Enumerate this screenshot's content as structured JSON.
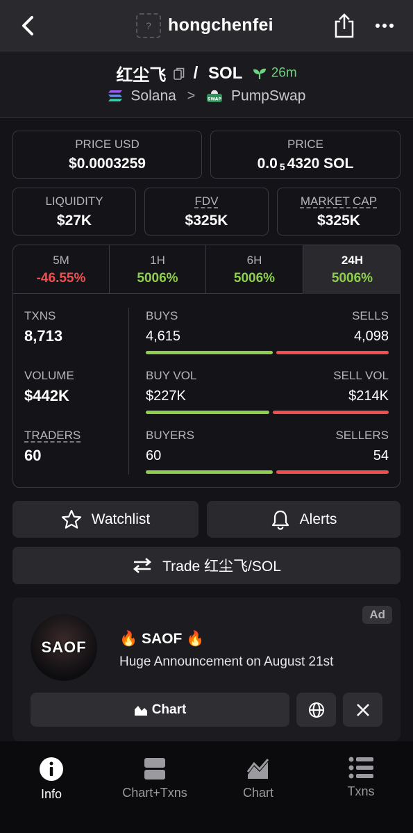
{
  "topbar": {
    "username": "hongchenfei",
    "avatar_placeholder": "?"
  },
  "header": {
    "pair_base": "红尘飞",
    "pair_separator": "/",
    "pair_quote": "SOL",
    "age": "26m",
    "chain": "Solana",
    "dex": "PumpSwap"
  },
  "price_cards": {
    "price_usd_label": "PRICE USD",
    "price_usd_value": "$0.0003259",
    "price_label": "PRICE",
    "price_prefix": "0.0",
    "price_zeros": "5",
    "price_suffix": "4320 SOL"
  },
  "metrics": {
    "liquidity_label": "LIQUIDITY",
    "liquidity_value": "$27K",
    "fdv_label": "FDV",
    "fdv_value": "$325K",
    "mcap_label": "MARKET CAP",
    "mcap_value": "$325K"
  },
  "timeframes": [
    {
      "label": "5M",
      "change": "-46.55%"
    },
    {
      "label": "1H",
      "change": "5006%"
    },
    {
      "label": "6H",
      "change": "5006%"
    },
    {
      "label": "24H",
      "change": "5006%"
    }
  ],
  "stats": {
    "txns_label": "TXNS",
    "txns_value": "8,713",
    "volume_label": "VOLUME",
    "volume_value": "$442K",
    "traders_label": "TRADERS",
    "traders_value": "60",
    "buys_label": "BUYS",
    "buys_value": "4,615",
    "sells_label": "SELLS",
    "sells_value": "4,098",
    "buy_vol_label": "BUY VOL",
    "buy_vol_value": "$227K",
    "sell_vol_label": "SELL VOL",
    "sell_vol_value": "$214K",
    "buyers_label": "BUYERS",
    "buyers_value": "60",
    "sellers_label": "SELLERS",
    "sellers_value": "54",
    "buys_ratio": 0.53,
    "buy_vol_ratio": 0.515,
    "buyers_ratio": 0.53
  },
  "actions": {
    "watchlist_label": "Watchlist",
    "alerts_label": "Alerts",
    "trade_label": "Trade 红尘飞/SOL"
  },
  "ad": {
    "badge": "Ad",
    "logo_text": "SAOF",
    "title": "🔥 SAOF 🔥",
    "subtitle": "Huge Announcement on August 21st",
    "chart_label": "Chart"
  },
  "nav": [
    {
      "label": "Info"
    },
    {
      "label": "Chart+Txns"
    },
    {
      "label": "Chart"
    },
    {
      "label": "Txns"
    }
  ],
  "colors": {
    "positive": "#8fcf4f",
    "negative": "#f04f4f",
    "age": "#6fd27e"
  }
}
